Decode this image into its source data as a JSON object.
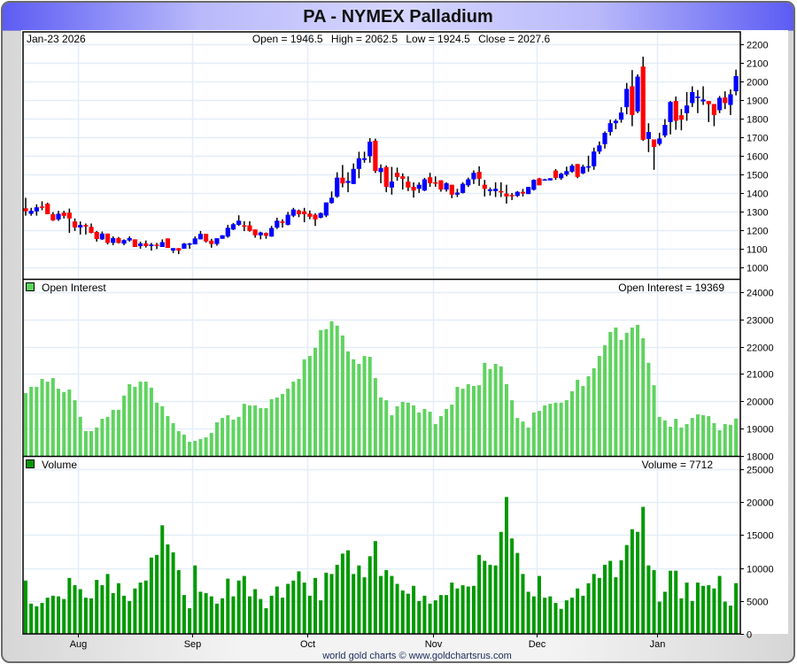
{
  "title": "PA  -  NYMEX Palladium",
  "price_header": {
    "date": "Jan-23  2026",
    "open_label": "Open =",
    "open": "1946.5",
    "high_label": "High =",
    "high": "2062.5",
    "low_label": "Low =",
    "low": "1924.5",
    "close_label": "Close =",
    "close": "2027.6"
  },
  "oi_header": {
    "legend": "Open Interest",
    "readout": "Open Interest = 19369"
  },
  "volume_header": {
    "legend": "Volume",
    "readout": "Volume = 7712"
  },
  "footer": "world gold charts © www.goldchartsrus.com",
  "colors": {
    "up": "#0000ff",
    "down": "#ff0000",
    "open_interest": "#5fd35f",
    "volume": "#009900",
    "grid": "#e4eef8"
  },
  "x_axis": {
    "ticks": [
      {
        "label": "Aug",
        "bar": 11
      },
      {
        "label": "Sep",
        "bar": 32
      },
      {
        "label": "Oct",
        "bar": 53
      },
      {
        "label": "Nov",
        "bar": 76
      },
      {
        "label": "Dec",
        "bar": 95
      },
      {
        "label": "Jan",
        "bar": 117
      }
    ]
  },
  "chart_data": [
    {
      "type": "candlestick",
      "ylim": [
        940,
        2265
      ],
      "y_ticks": [
        1000,
        1100,
        1200,
        1300,
        1400,
        1500,
        1600,
        1700,
        1800,
        1900,
        2000,
        2100,
        2200
      ],
      "grid": true,
      "open": [
        1319,
        1289,
        1302,
        1328,
        1343,
        1287,
        1259,
        1295,
        1295,
        1248,
        1216,
        1229,
        1219,
        1192,
        1152,
        1183,
        1133,
        1159,
        1129,
        1146,
        1152,
        1116,
        1130,
        1116,
        1124,
        1111,
        1157,
        1092,
        1105,
        1102,
        1124,
        1125,
        1152,
        1181,
        1145,
        1127,
        1155,
        1167,
        1205,
        1230,
        1227,
        1227,
        1205,
        1174,
        1186,
        1167,
        1215,
        1248,
        1230,
        1279,
        1307,
        1302,
        1290,
        1284,
        1268,
        1280,
        1347,
        1381,
        1483,
        1455,
        1449,
        1530,
        1578,
        1598,
        1681,
        1513,
        1540,
        1430,
        1509,
        1490,
        1462,
        1434,
        1423,
        1414,
        1485,
        1458,
        1469,
        1419,
        1445,
        1392,
        1401,
        1442,
        1474,
        1514,
        1445,
        1411,
        1411,
        1411,
        1398,
        1390,
        1385,
        1407,
        1395,
        1418,
        1479,
        1469,
        1468,
        1521,
        1480,
        1499,
        1515,
        1556,
        1506,
        1537,
        1544,
        1623,
        1663,
        1728,
        1775,
        1794,
        1861,
        1973,
        1838,
        2079,
        1691,
        1688,
        1664,
        1709,
        1781,
        1894,
        1818,
        1829,
        1883,
        1910,
        1892,
        1894,
        1878,
        1845,
        1913,
        1873,
        1946.5
      ],
      "high": [
        1375,
        1321,
        1340,
        1356,
        1349,
        1298,
        1305,
        1305,
        1317,
        1264,
        1248,
        1237,
        1237,
        1197,
        1194,
        1183,
        1168,
        1165,
        1152,
        1168,
        1152,
        1140,
        1146,
        1133,
        1133,
        1152,
        1157,
        1105,
        1105,
        1133,
        1133,
        1168,
        1197,
        1181,
        1155,
        1158,
        1174,
        1230,
        1240,
        1281,
        1249,
        1249,
        1205,
        1193,
        1189,
        1224,
        1268,
        1260,
        1299,
        1321,
        1312,
        1321,
        1307,
        1292,
        1296,
        1350,
        1409,
        1512,
        1551,
        1512,
        1559,
        1622,
        1622,
        1695,
        1692,
        1554,
        1548,
        1541,
        1537,
        1506,
        1490,
        1458,
        1458,
        1482,
        1509,
        1490,
        1469,
        1458,
        1445,
        1423,
        1458,
        1483,
        1522,
        1544,
        1471,
        1430,
        1458,
        1458,
        1445,
        1401,
        1411,
        1423,
        1433,
        1474,
        1482,
        1477,
        1480,
        1529,
        1509,
        1542,
        1556,
        1556,
        1553,
        1601,
        1644,
        1677,
        1731,
        1794,
        1797,
        1861,
        1991,
        2060,
        2037,
        2132,
        1775,
        1688,
        1724,
        1797,
        1894,
        1918,
        1851,
        1942,
        1973,
        1953,
        1973,
        1894,
        1878,
        1921,
        1946,
        1956,
        2062.5
      ],
      "low": [
        1279,
        1279,
        1279,
        1308,
        1287,
        1251,
        1251,
        1264,
        1187,
        1197,
        1178,
        1178,
        1184,
        1140,
        1149,
        1125,
        1121,
        1130,
        1121,
        1140,
        1111,
        1102,
        1108,
        1092,
        1100,
        1111,
        1106,
        1079,
        1073,
        1102,
        1102,
        1125,
        1152,
        1135,
        1107,
        1118,
        1155,
        1161,
        1202,
        1224,
        1196,
        1193,
        1161,
        1152,
        1155,
        1166,
        1208,
        1215,
        1227,
        1271,
        1271,
        1244,
        1260,
        1224,
        1265,
        1271,
        1343,
        1375,
        1431,
        1405,
        1449,
        1480,
        1563,
        1563,
        1508,
        1453,
        1405,
        1392,
        1466,
        1419,
        1411,
        1376,
        1401,
        1411,
        1434,
        1434,
        1408,
        1408,
        1373,
        1379,
        1398,
        1433,
        1449,
        1439,
        1382,
        1387,
        1379,
        1379,
        1344,
        1363,
        1379,
        1382,
        1395,
        1414,
        1442,
        1469,
        1468,
        1471,
        1471,
        1490,
        1509,
        1480,
        1502,
        1515,
        1525,
        1610,
        1639,
        1709,
        1743,
        1778,
        1823,
        1759,
        1829,
        1680,
        1620,
        1525,
        1655,
        1699,
        1715,
        1740,
        1737,
        1788,
        1862,
        1829,
        1873,
        1781,
        1759,
        1829,
        1851,
        1819,
        1924.5
      ],
      "close": [
        1303,
        1305,
        1324,
        1326,
        1287,
        1254,
        1289,
        1278,
        1264,
        1216,
        1229,
        1221,
        1187,
        1154,
        1183,
        1133,
        1159,
        1133,
        1148,
        1159,
        1111,
        1130,
        1116,
        1124,
        1118,
        1137,
        1106,
        1105,
        1092,
        1129,
        1130,
        1157,
        1181,
        1141,
        1127,
        1158,
        1174,
        1214,
        1233,
        1252,
        1221,
        1197,
        1174,
        1189,
        1171,
        1213,
        1252,
        1240,
        1284,
        1312,
        1287,
        1287,
        1273,
        1259,
        1293,
        1350,
        1375,
        1483,
        1452,
        1465,
        1530,
        1587,
        1587,
        1676,
        1519,
        1535,
        1433,
        1462,
        1487,
        1477,
        1430,
        1414,
        1445,
        1474,
        1453,
        1453,
        1419,
        1453,
        1392,
        1403,
        1450,
        1474,
        1509,
        1477,
        1423,
        1420,
        1423,
        1407,
        1382,
        1385,
        1407,
        1398,
        1433,
        1471,
        1442,
        1474,
        1480,
        1482,
        1504,
        1518,
        1547,
        1487,
        1542,
        1544,
        1623,
        1656,
        1723,
        1775,
        1788,
        1832,
        1959,
        1819,
        2025,
        1686,
        1728,
        1648,
        1693,
        1766,
        1889,
        1788,
        1794,
        1870,
        1942,
        1918,
        1902,
        1877,
        1819,
        1911,
        1883,
        1930,
        2027.6
      ]
    },
    {
      "type": "bar",
      "name": "Open Interest",
      "ylim": [
        18000,
        24450
      ],
      "y_ticks": [
        18000,
        19000,
        20000,
        21000,
        22000,
        23000,
        24000
      ],
      "grid": true,
      "values": [
        20300,
        20530,
        20530,
        20820,
        20720,
        20850,
        20460,
        20340,
        20430,
        20040,
        19430,
        18910,
        18910,
        19040,
        19360,
        19430,
        19690,
        19690,
        20210,
        20630,
        20530,
        20720,
        20720,
        20500,
        19950,
        19820,
        19460,
        19200,
        18910,
        18780,
        18520,
        18550,
        18620,
        18680,
        18840,
        19230,
        19390,
        19490,
        19330,
        19430,
        19910,
        19850,
        19850,
        19750,
        19750,
        20080,
        20140,
        20270,
        20460,
        20720,
        20820,
        21540,
        21660,
        21960,
        22610,
        22640,
        22930,
        22770,
        22410,
        21830,
        21540,
        21370,
        21660,
        21630,
        20850,
        20140,
        20040,
        19490,
        19820,
        19980,
        19950,
        19850,
        19590,
        19720,
        19620,
        19170,
        19460,
        19720,
        19880,
        20530,
        20460,
        20630,
        20560,
        20590,
        21410,
        21180,
        21370,
        21280,
        20630,
        20040,
        19390,
        19260,
        19040,
        19590,
        19650,
        19850,
        19910,
        19950,
        19950,
        20040,
        20370,
        20790,
        20560,
        20920,
        21210,
        21660,
        22050,
        22540,
        22700,
        22250,
        22510,
        22700,
        22800,
        22310,
        21410,
        20590,
        19430,
        19300,
        19070,
        19360,
        19040,
        19170,
        19390,
        19520,
        19490,
        19460,
        19200,
        18940,
        19170,
        19140,
        19369
      ]
    },
    {
      "type": "bar",
      "name": "Volume",
      "ylim": [
        0,
        26900
      ],
      "y_ticks": [
        0,
        5000,
        10000,
        15000,
        20000,
        25000
      ],
      "grid": true,
      "values": [
        8100,
        4600,
        4200,
        4700,
        5500,
        5800,
        5700,
        5300,
        8500,
        7400,
        6800,
        5500,
        5400,
        8200,
        7400,
        9100,
        6200,
        7700,
        5800,
        5000,
        6900,
        7800,
        8100,
        11600,
        12000,
        16500,
        13600,
        12400,
        9700,
        5900,
        3900,
        10400,
        6400,
        6200,
        5700,
        4600,
        5400,
        8400,
        5700,
        8100,
        8800,
        5700,
        6800,
        5300,
        3900,
        5800,
        7200,
        5500,
        7600,
        8100,
        9500,
        7800,
        5800,
        8500,
        5100,
        9300,
        9100,
        10500,
        12200,
        12700,
        9100,
        10400,
        8600,
        11800,
        14100,
        8800,
        9700,
        8800,
        7600,
        6600,
        6100,
        7300,
        5000,
        5800,
        4600,
        5100,
        5900,
        5900,
        7800,
        6900,
        7400,
        7200,
        7300,
        12000,
        11100,
        10500,
        10400,
        15500,
        20800,
        14500,
        12300,
        9100,
        6400,
        5700,
        8800,
        5500,
        5700,
        4700,
        3800,
        5100,
        5500,
        6900,
        5800,
        7700,
        9100,
        8500,
        10500,
        11100,
        8600,
        11200,
        13500,
        15900,
        15500,
        19300,
        10400,
        9700,
        4900,
        6400,
        9600,
        9600,
        5400,
        7800,
        5000,
        7800,
        7300,
        7400,
        6900,
        8800,
        4900,
        4300,
        7712
      ]
    }
  ]
}
